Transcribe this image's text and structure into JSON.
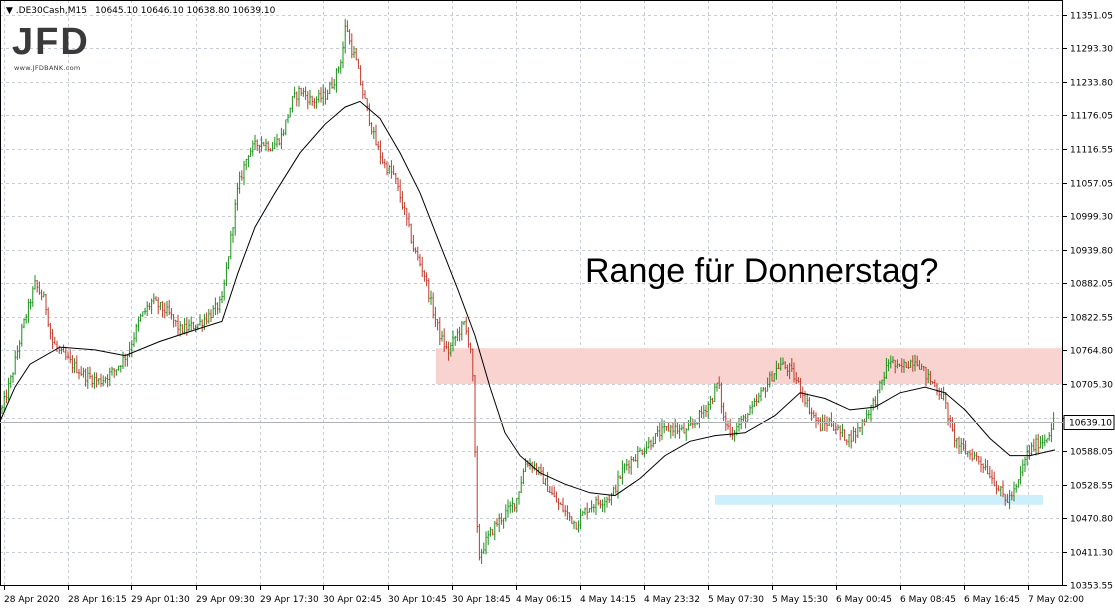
{
  "header": {
    "symbol": ".DE30Cash,M15",
    "ohlc": "10645.10 10646.10 10638.80 10639.10"
  },
  "logo": {
    "text": "JFD",
    "url": "www.JFDBANK.com"
  },
  "colors": {
    "bull": "#1a8f1a",
    "bear": "#c0392b",
    "ma": "#000000",
    "grid": "#c8ccd4",
    "resistance_zone": "#f9d3d0",
    "support_zone": "#cdeefb",
    "price_box_bg": "#ffffff",
    "price_line": "#b0b0b0"
  },
  "chart_data": {
    "type": "candlestick",
    "title": "",
    "annotation": "Range für Donnerstag?",
    "ylim": [
      10353.55,
      11360
    ],
    "y_ticks": [
      "11351.05",
      "11293.30",
      "11233.80",
      "11176.05",
      "11116.55",
      "11057.05",
      "10999.30",
      "10939.80",
      "10882.05",
      "10822.55",
      "10764.80",
      "10705.30",
      "10645.80",
      "10588.05",
      "10528.55",
      "10470.80",
      "10411.30",
      "10353.55"
    ],
    "x_ticks": [
      "28 Apr 2020",
      "28 Apr 16:15",
      "29 Apr 01:30",
      "29 Apr 09:30",
      "29 Apr 17:30",
      "30 Apr 02:45",
      "30 Apr 10:45",
      "30 Apr 18:45",
      "4 May 06:15",
      "4 May 14:15",
      "4 May 23:32",
      "5 May 07:30",
      "5 May 15:30",
      "6 May 00:45",
      "6 May 08:45",
      "6 May 16:45",
      "7 May 02:00"
    ],
    "current_price": 10639.1,
    "zones": [
      {
        "name": "resistance",
        "from": 10705.3,
        "to": 10768
      },
      {
        "name": "support",
        "from": 10494,
        "to": 10511
      }
    ],
    "price_path": [
      [
        0,
        10650
      ],
      [
        12,
        10720
      ],
      [
        22,
        10800
      ],
      [
        35,
        10880
      ],
      [
        45,
        10850
      ],
      [
        52,
        10780
      ],
      [
        60,
        10760
      ],
      [
        72,
        10740
      ],
      [
        85,
        10720
      ],
      [
        100,
        10710
      ],
      [
        115,
        10730
      ],
      [
        128,
        10760
      ],
      [
        140,
        10820
      ],
      [
        152,
        10850
      ],
      [
        168,
        10830
      ],
      [
        180,
        10800
      ],
      [
        198,
        10810
      ],
      [
        212,
        10830
      ],
      [
        222,
        10850
      ],
      [
        230,
        10950
      ],
      [
        238,
        11050
      ],
      [
        248,
        11110
      ],
      [
        260,
        11130
      ],
      [
        272,
        11120
      ],
      [
        282,
        11140
      ],
      [
        292,
        11200
      ],
      [
        300,
        11220
      ],
      [
        312,
        11200
      ],
      [
        325,
        11210
      ],
      [
        335,
        11240
      ],
      [
        342,
        11280
      ],
      [
        346,
        11340
      ],
      [
        350,
        11300
      ],
      [
        356,
        11270
      ],
      [
        362,
        11220
      ],
      [
        368,
        11180
      ],
      [
        375,
        11130
      ],
      [
        384,
        11090
      ],
      [
        394,
        11070
      ],
      [
        404,
        11010
      ],
      [
        414,
        10940
      ],
      [
        424,
        10900
      ],
      [
        432,
        10840
      ],
      [
        440,
        10790
      ],
      [
        448,
        10760
      ],
      [
        456,
        10790
      ],
      [
        464,
        10810
      ],
      [
        472,
        10760
      ],
      [
        478,
        10400
      ],
      [
        486,
        10430
      ],
      [
        496,
        10460
      ],
      [
        506,
        10480
      ],
      [
        516,
        10500
      ],
      [
        526,
        10570
      ],
      [
        536,
        10560
      ],
      [
        546,
        10530
      ],
      [
        556,
        10500
      ],
      [
        566,
        10480
      ],
      [
        576,
        10460
      ],
      [
        588,
        10490
      ],
      [
        600,
        10500
      ],
      [
        612,
        10510
      ],
      [
        624,
        10560
      ],
      [
        636,
        10580
      ],
      [
        648,
        10600
      ],
      [
        660,
        10620
      ],
      [
        672,
        10630
      ],
      [
        686,
        10620
      ],
      [
        700,
        10650
      ],
      [
        712,
        10680
      ],
      [
        718,
        10710
      ],
      [
        724,
        10640
      ],
      [
        732,
        10620
      ],
      [
        742,
        10640
      ],
      [
        752,
        10660
      ],
      [
        762,
        10690
      ],
      [
        772,
        10720
      ],
      [
        780,
        10740
      ],
      [
        790,
        10730
      ],
      [
        800,
        10700
      ],
      [
        810,
        10660
      ],
      [
        820,
        10630
      ],
      [
        830,
        10640
      ],
      [
        840,
        10620
      ],
      [
        848,
        10610
      ],
      [
        856,
        10620
      ],
      [
        866,
        10650
      ],
      [
        876,
        10680
      ],
      [
        884,
        10720
      ],
      [
        890,
        10750
      ],
      [
        898,
        10730
      ],
      [
        906,
        10740
      ],
      [
        916,
        10750
      ],
      [
        926,
        10720
      ],
      [
        936,
        10700
      ],
      [
        944,
        10680
      ],
      [
        952,
        10620
      ],
      [
        962,
        10590
      ],
      [
        974,
        10580
      ],
      [
        986,
        10560
      ],
      [
        996,
        10530
      ],
      [
        1006,
        10500
      ],
      [
        1016,
        10520
      ],
      [
        1026,
        10580
      ],
      [
        1036,
        10600
      ],
      [
        1046,
        10610
      ],
      [
        1055,
        10645
      ]
    ],
    "ma_path": [
      [
        0,
        10640
      ],
      [
        15,
        10700
      ],
      [
        30,
        10740
      ],
      [
        60,
        10770
      ],
      [
        95,
        10765
      ],
      [
        125,
        10755
      ],
      [
        160,
        10780
      ],
      [
        195,
        10800
      ],
      [
        222,
        10815
      ],
      [
        238,
        10900
      ],
      [
        255,
        10980
      ],
      [
        275,
        11040
      ],
      [
        300,
        11110
      ],
      [
        325,
        11160
      ],
      [
        345,
        11190
      ],
      [
        360,
        11200
      ],
      [
        380,
        11170
      ],
      [
        400,
        11110
      ],
      [
        420,
        11040
      ],
      [
        440,
        10950
      ],
      [
        458,
        10870
      ],
      [
        475,
        10790
      ],
      [
        490,
        10700
      ],
      [
        505,
        10620
      ],
      [
        520,
        10580
      ],
      [
        540,
        10550
      ],
      [
        565,
        10530
      ],
      [
        590,
        10515
      ],
      [
        615,
        10510
      ],
      [
        640,
        10540
      ],
      [
        665,
        10580
      ],
      [
        690,
        10605
      ],
      [
        715,
        10615
      ],
      [
        745,
        10620
      ],
      [
        775,
        10650
      ],
      [
        800,
        10690
      ],
      [
        825,
        10680
      ],
      [
        850,
        10660
      ],
      [
        875,
        10665
      ],
      [
        900,
        10690
      ],
      [
        925,
        10700
      ],
      [
        945,
        10690
      ],
      [
        965,
        10660
      ],
      [
        990,
        10610
      ],
      [
        1010,
        10580
      ],
      [
        1030,
        10580
      ],
      [
        1055,
        10590
      ]
    ]
  }
}
